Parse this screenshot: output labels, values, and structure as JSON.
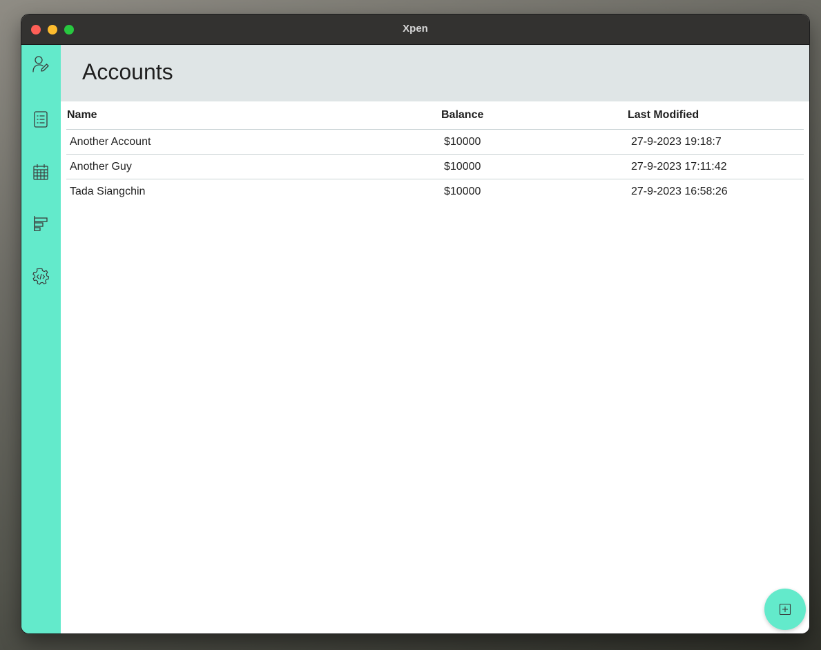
{
  "window": {
    "title": "Xpen"
  },
  "sidebar": {
    "items": [
      {
        "name": "accounts",
        "icon": "user-edit-icon"
      },
      {
        "name": "transactions",
        "icon": "list-icon"
      },
      {
        "name": "calendar",
        "icon": "calendar-icon"
      },
      {
        "name": "reports",
        "icon": "bar-chart-icon"
      },
      {
        "name": "developer-settings",
        "icon": "gear-code-icon"
      }
    ]
  },
  "page": {
    "title": "Accounts"
  },
  "table": {
    "columns": {
      "name": "Name",
      "balance": "Balance",
      "last_modified": "Last Modified"
    },
    "rows": [
      {
        "name": "Another Account",
        "balance": "$10000",
        "last_modified": "27-9-2023 19:18:7"
      },
      {
        "name": "Another Guy",
        "balance": "$10000",
        "last_modified": "27-9-2023 17:11:42"
      },
      {
        "name": "Tada Siangchin",
        "balance": "$10000",
        "last_modified": "27-9-2023 16:58:26"
      }
    ]
  },
  "fab": {
    "icon": "plus-square-icon"
  },
  "colors": {
    "accent": "#63eacb",
    "header_bg": "#dfe5e6",
    "titlebar": "#333230"
  }
}
